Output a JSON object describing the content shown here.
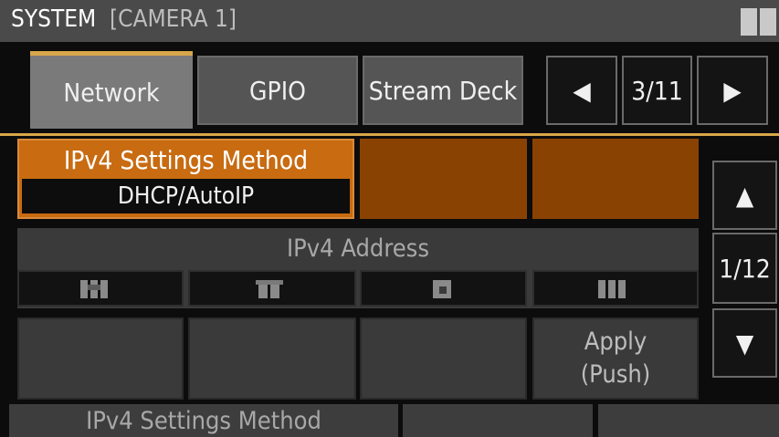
{
  "header": {
    "title": "SYSTEM",
    "camera": "[CAMERA 1]"
  },
  "tabs": [
    {
      "label": "Network",
      "active": true
    },
    {
      "label": "GPIO",
      "active": false
    },
    {
      "label": "Stream Deck",
      "active": false
    }
  ],
  "tab_nav": {
    "prev_icon": "◀",
    "page": "3/11",
    "next_icon": "▶"
  },
  "settings": {
    "ipv4_method_label": "IPv4 Settings Method",
    "ipv4_method_value": "DHCP/AutoIP",
    "ipv4_address_label": "IPv4 Address",
    "apply_label": "Apply",
    "apply_sub": "(Push)"
  },
  "scroll": {
    "up_icon": "▲",
    "page": "1/12",
    "down_icon": "▼"
  },
  "footer": {
    "status_label": "IPv4 Settings Method"
  },
  "colors": {
    "accent": "#d7a74a",
    "selected_cell": "#c86b11",
    "orange_cell": "#8a4203"
  }
}
